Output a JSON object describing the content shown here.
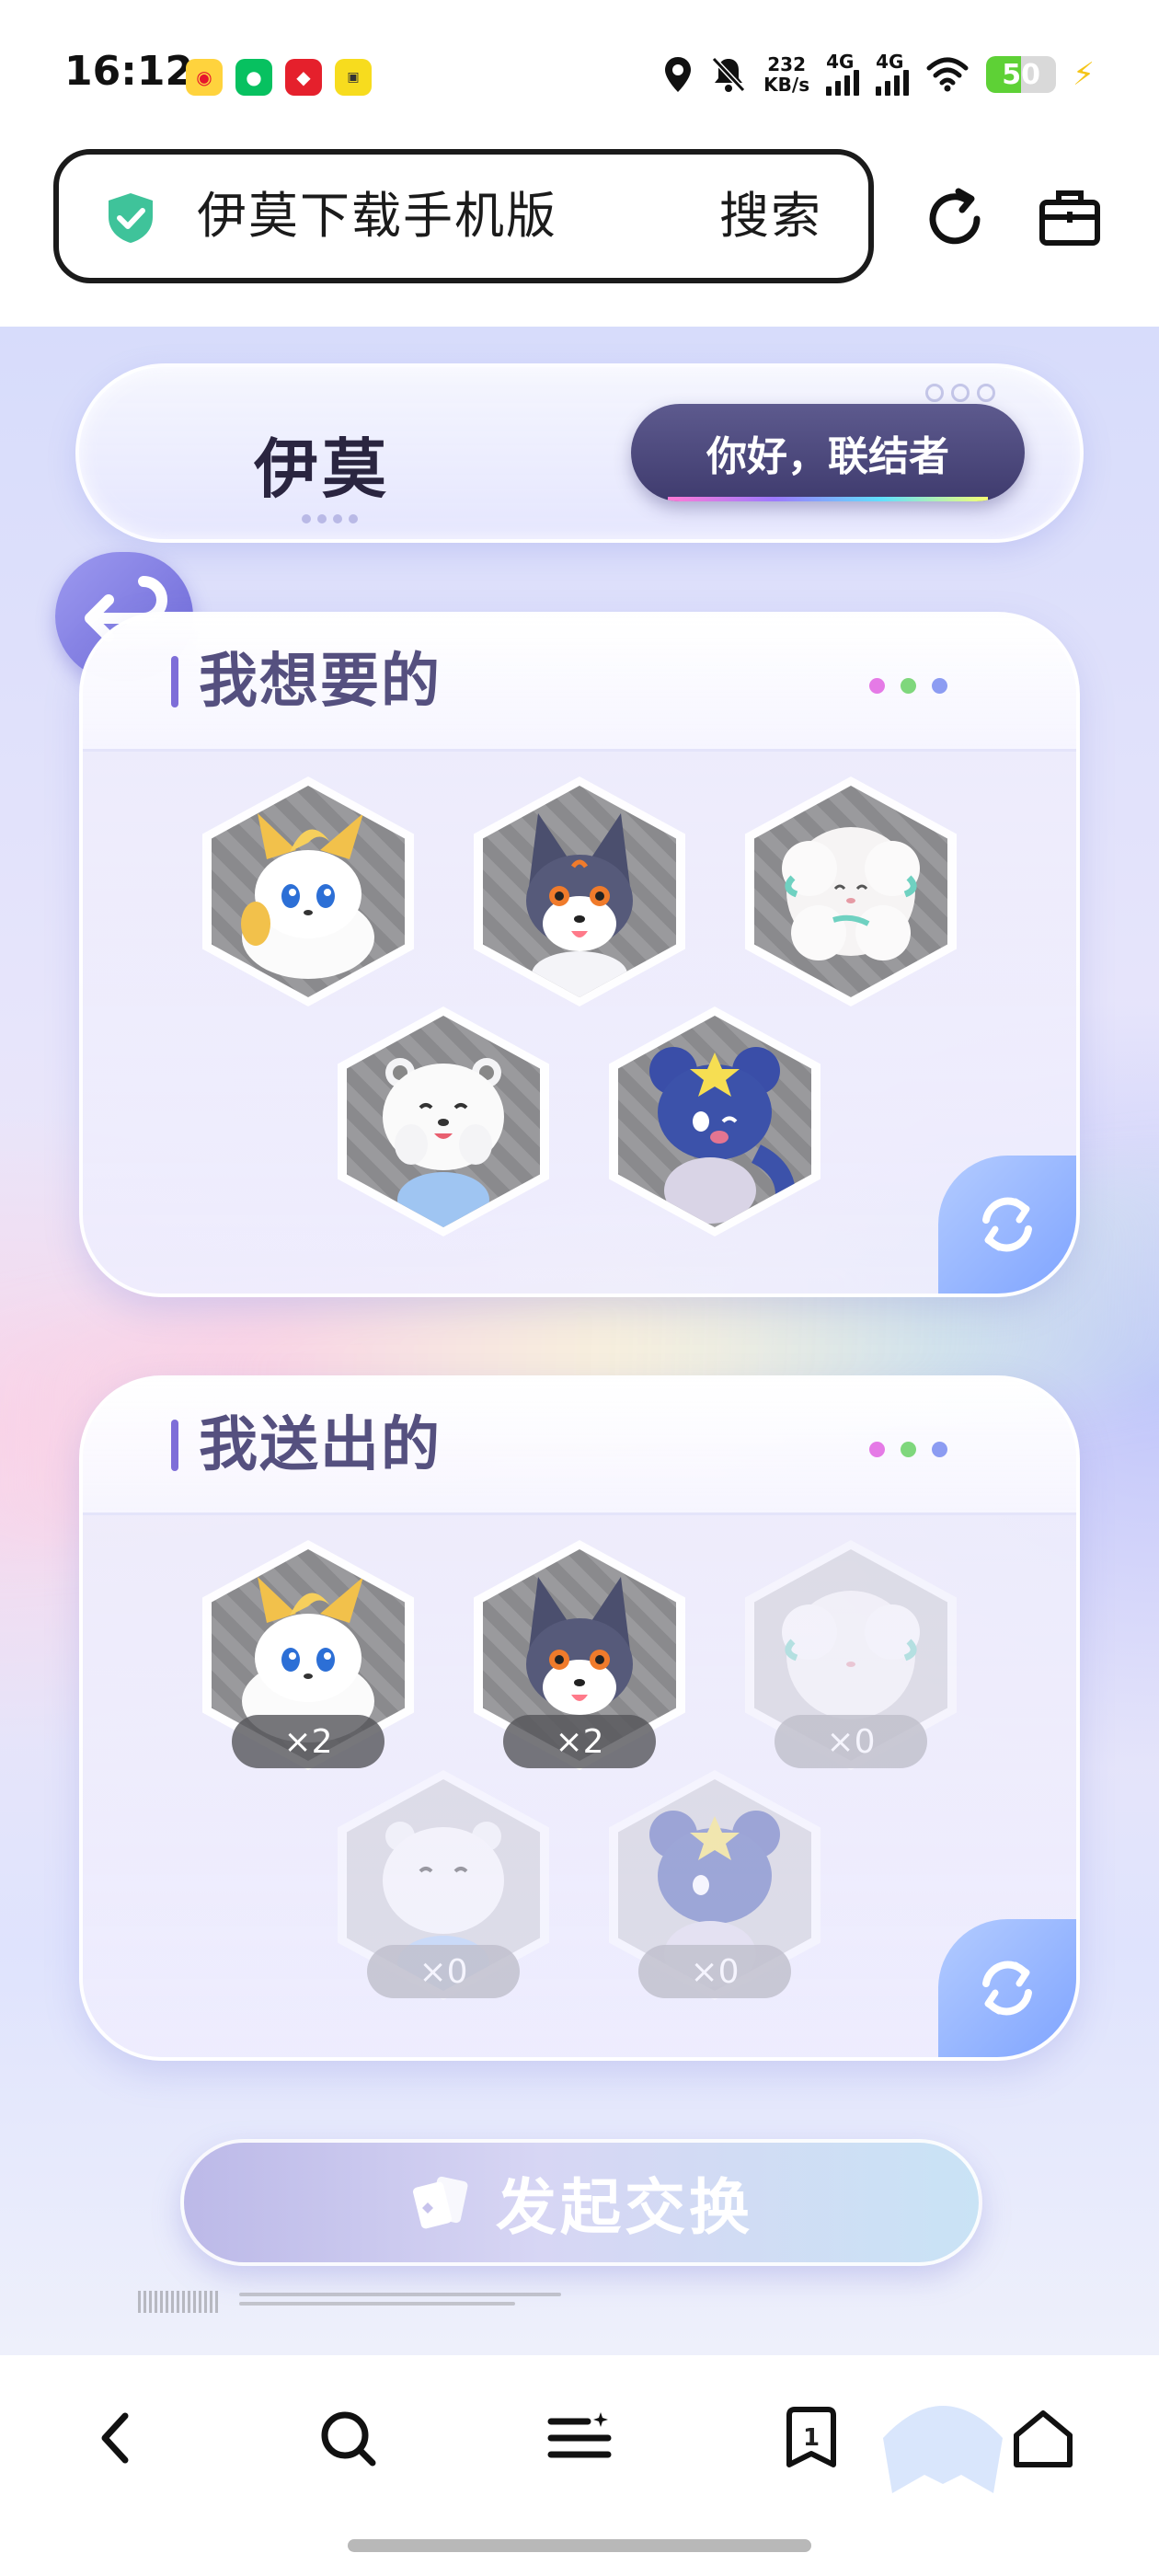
{
  "status_bar": {
    "time": "16:12",
    "net_speed_value": "232",
    "net_speed_unit": "KB/s",
    "signal_1_label": "4G",
    "signal_2_label": "4G",
    "battery_level": "50",
    "app_icons": [
      "weibo-icon",
      "wechat-icon",
      "red-app-icon",
      "yellow-app-icon"
    ]
  },
  "browser": {
    "search_text": "伊莫下载手机版",
    "search_button": "搜索"
  },
  "header": {
    "logo": "伊莫",
    "greeting_button": "你好，联结者"
  },
  "want_section": {
    "title": "我想要的",
    "pets": [
      {
        "name": "golden-fox-pet"
      },
      {
        "name": "gray-fox-pet"
      },
      {
        "name": "fluffy-sheep-pet"
      },
      {
        "name": "white-bear-pet"
      },
      {
        "name": "blue-star-mouse-pet"
      }
    ]
  },
  "give_section": {
    "title": "我送出的",
    "pets": [
      {
        "name": "golden-fox-pet",
        "count": "×2",
        "available": true
      },
      {
        "name": "gray-fox-pet",
        "count": "×2",
        "available": true
      },
      {
        "name": "fluffy-sheep-pet",
        "count": "×0",
        "available": false
      },
      {
        "name": "white-bear-pet",
        "count": "×0",
        "available": false
      },
      {
        "name": "blue-star-mouse-pet",
        "count": "×0",
        "available": false
      }
    ]
  },
  "actions": {
    "exchange_button": "发起交换"
  },
  "bottom_nav": {
    "tab_count": "1"
  },
  "colors": {
    "accent_purple": "#55507f",
    "greet_button": "#4a4680",
    "refresh_blue": "#8fb0ff",
    "battery_green": "#5ed136"
  }
}
